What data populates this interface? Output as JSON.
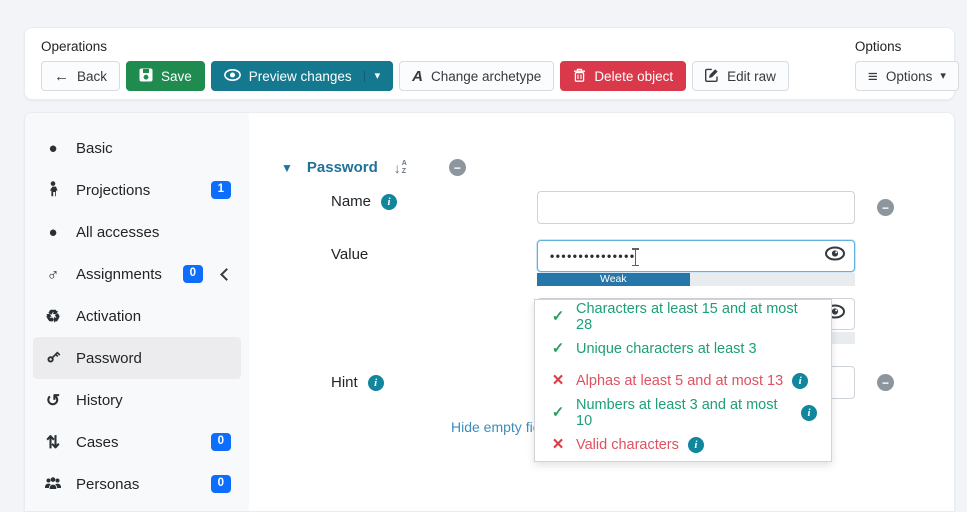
{
  "toolbar": {
    "operations_label": "Operations",
    "back": "Back",
    "save": "Save",
    "preview": "Preview changes",
    "change_archetype": "Change archetype",
    "delete": "Delete object",
    "edit_raw": "Edit raw",
    "options_label": "Options",
    "options_button": "Options"
  },
  "sidebar": {
    "items": [
      {
        "label": "Basic"
      },
      {
        "label": "Projections",
        "badge": "1"
      },
      {
        "label": "All accesses"
      },
      {
        "label": "Assignments",
        "badge": "0"
      },
      {
        "label": "Activation"
      },
      {
        "label": "Password"
      },
      {
        "label": "History"
      },
      {
        "label": "Cases",
        "badge": "0"
      },
      {
        "label": "Personas",
        "badge": "0"
      }
    ]
  },
  "content": {
    "section_title": "Password",
    "name_label": "Name",
    "value_label": "Value",
    "hint_label": "Hint",
    "value_masked": "•••••••••••••••",
    "strength_label": "Weak",
    "hide_link": "Hide empty fields",
    "validation": [
      {
        "status": "pass",
        "text": "Characters at least 15 and at most 28"
      },
      {
        "status": "pass",
        "text": "Unique characters at least 3"
      },
      {
        "status": "fail",
        "text": "Alphas at least 5 and at most 13"
      },
      {
        "status": "pass",
        "text": "Numbers at least 3 and at most 10"
      },
      {
        "status": "fail",
        "text": "Valid characters"
      }
    ]
  },
  "icons": {
    "back_arrow": "←",
    "caret_down": "▾",
    "section_caret": "▼",
    "bars": "≡",
    "archetype": "A",
    "minus": "−",
    "info": "i",
    "check": "✓",
    "cross": "×",
    "circle": "●",
    "assignments": "♂",
    "recycle": "♻",
    "history": "↺",
    "cases": "⇅",
    "sort_arrow": "↓",
    "sort_a": "A",
    "sort_z": "Z"
  },
  "colors": {
    "badge_blue": "#0d6efd",
    "save_green": "#1f8b4f",
    "preview_teal": "#14788f",
    "delete_red": "#d9394a",
    "header_blue": "#1f7299",
    "valid_green": "#1e9e78",
    "invalid_red": "#e0505f",
    "strength_fill": "#2776a9",
    "info_teal": "#11869c",
    "link_blue": "#3c8dbc"
  }
}
